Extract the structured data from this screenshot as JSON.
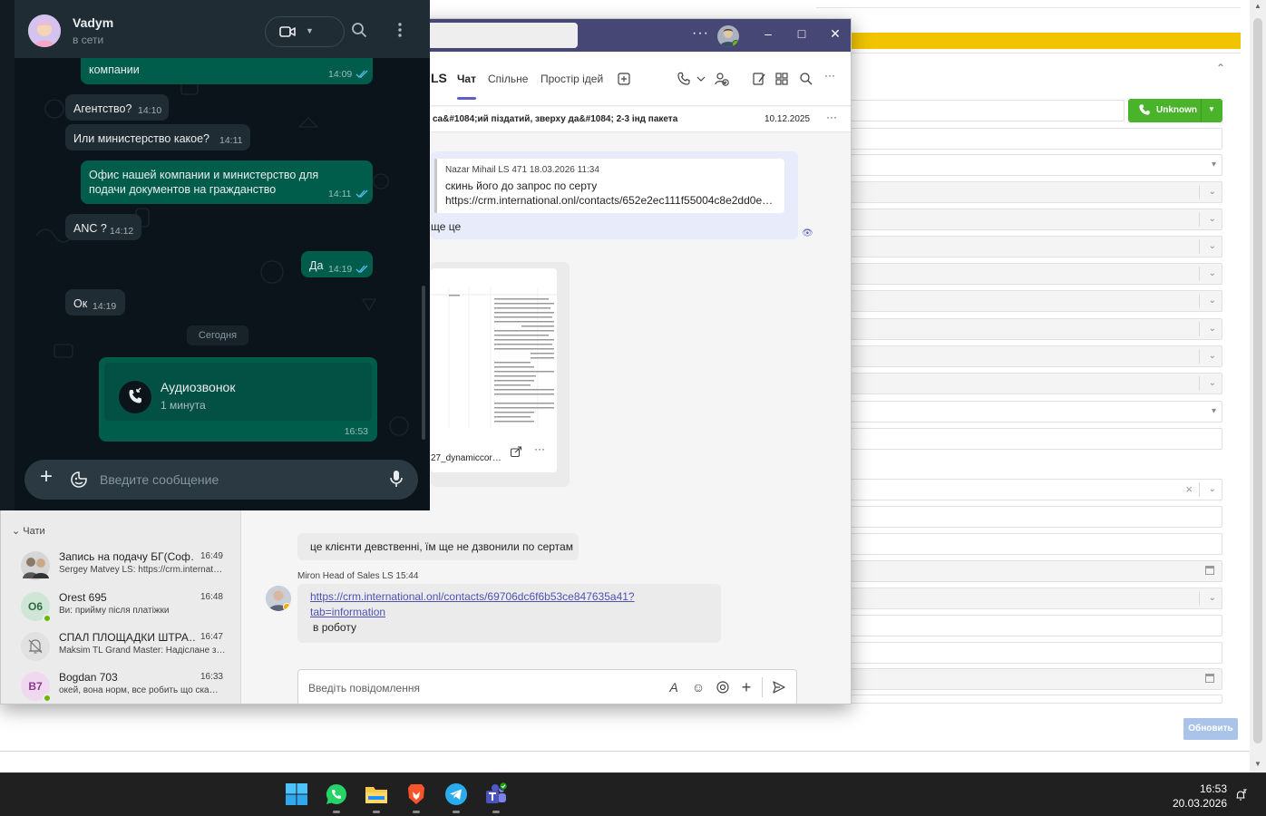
{
  "whatsapp": {
    "contact_name": "Vadym",
    "contact_status": "в сети",
    "messages": [
      {
        "dir": "out",
        "text": "компании",
        "time": "14:09",
        "ticks": true
      },
      {
        "dir": "in",
        "text": "Агентство?",
        "time": "14:10"
      },
      {
        "dir": "in",
        "text": "Или министерство какое?",
        "time": "14:11"
      },
      {
        "dir": "out",
        "text_line1": "Офис нашей компании и министерство для",
        "text_line2": "подачи документов на гражданство",
        "time": "14:11",
        "ticks": true
      },
      {
        "dir": "in",
        "text": "ANC ?",
        "time": "14:12"
      },
      {
        "dir": "out",
        "text": "Да",
        "time": "14:19",
        "ticks": true
      },
      {
        "dir": "in",
        "text": "Ок",
        "time": "14:19"
      }
    ],
    "date_chip": "Сегодня",
    "call": {
      "title": "Аудиозвонок",
      "duration": "1 минута",
      "time": "16:53"
    },
    "input_placeholder": "Введите сообщение",
    "colors": {
      "outgoing": "#005c4b",
      "incoming": "#202c33",
      "background": "#0b141a"
    }
  },
  "teams": {
    "header": {
      "ls_text": "LS",
      "tabs": [
        "Чат",
        "Спільне",
        "Простір ідей"
      ],
      "active_tab": "Чат"
    },
    "pinned": {
      "text": "ca&#1084;ий піздатий, зверху да&#1084; 2-3 інд пакета",
      "date": "10.12.2025"
    },
    "quote": {
      "author_time": "Nazar Mihail LS 471   18.03.2026 11:34",
      "line1": "скинь його до запрос по серту",
      "line2": "https://crm.international.onl/contacts/652e2ec111f55004c8e2dd0e…",
      "tail": "ще це"
    },
    "file": {
      "name": "27_dynamiccor…"
    },
    "messages": [
      {
        "text": "це клієнти девственні, їм ще не дзвонили по сертам"
      }
    ],
    "sender_line": "Miron Head of Sales LS   15:44",
    "link_message": {
      "link_line1": "https://crm.international.onl/contacts/69706dc6f6b53ce847635a41?",
      "link_line2": "tab=information",
      "text": "в роботу"
    },
    "compose_placeholder": "Введіть повідомлення",
    "chats_section_label": "Чати",
    "chats": [
      {
        "name": "Запись на подачу БГ(Соф…",
        "time": "16:49",
        "preview": "Sergey Matvey LS: https://crm.internat…",
        "avatar": "group",
        "initials": ""
      },
      {
        "name": "Orest 695",
        "time": "16:48",
        "preview": "Ви: прийму після платіжки",
        "avatar": "initials",
        "initials": "О6",
        "color": "#d1e7dd"
      },
      {
        "name": "СПАЛ ПЛОЩАДКИ ШТРА…",
        "time": "16:47",
        "preview": "Maksim TL Grand Master: Надіслане з…",
        "avatar": "muted",
        "initials": ""
      },
      {
        "name": "Bogdan 703",
        "time": "16:33",
        "preview": "окей, вона норм, все робить що ска…",
        "avatar": "initials",
        "initials": "B7",
        "color": "#f0d9f3"
      }
    ],
    "colors": {
      "titlebar": "#464775",
      "accent": "#5b5fc7"
    }
  },
  "crm": {
    "call_button": "Unknown",
    "update_button": "Обновить",
    "colors": {
      "accent_yellow": "#f0c400",
      "green": "#49b32a"
    }
  },
  "taskbar": {
    "apps": [
      "windows-start-icon",
      "whatsapp-icon",
      "file-explorer-icon",
      "brave-browser-icon",
      "telegram-icon",
      "teams-icon"
    ],
    "time": "16:53",
    "date": "20.03.2026"
  }
}
